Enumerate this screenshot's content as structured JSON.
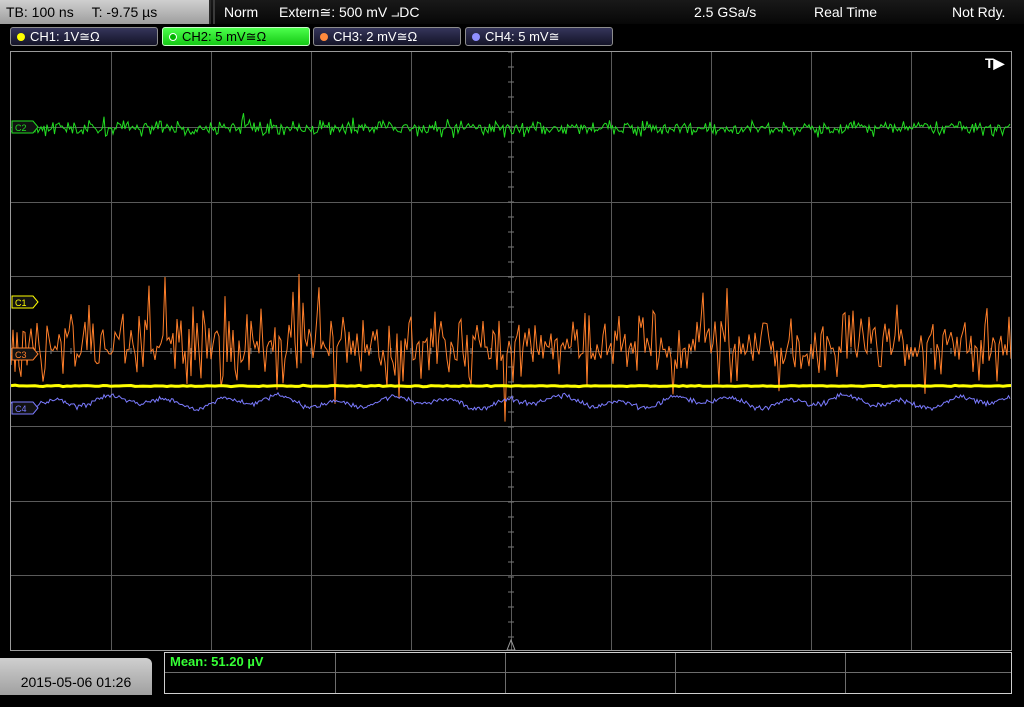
{
  "top_bar": {
    "timebase": "TB: 100 ns",
    "trigger_time": "T: -9.75 µs",
    "mode": "Norm",
    "trigger_source": "Extern≅: 500 mV ⨼DC",
    "sample_rate": "2.5 GSa/s",
    "acquisition_mode": "Real Time",
    "status": "Not Rdy."
  },
  "channels": [
    {
      "label": "CH1: 1V≅Ω",
      "color": "#ffff00",
      "active": false
    },
    {
      "label": "CH2: 5 mV≅Ω",
      "color": "#00e000",
      "active": true
    },
    {
      "label": "CH3: 2 mV≅Ω",
      "color": "#ff8a3d",
      "active": false
    },
    {
      "label": "CH4: 5 mV≅",
      "color": "#8080ff",
      "active": false
    }
  ],
  "markers": {
    "ch1": "C1",
    "ch2": "C2",
    "ch3": "C3",
    "ch4": "C4",
    "trigger_position": "T▶"
  },
  "bottom": {
    "datetime": "2015-05-06 01:26",
    "measurement": "Mean: 51.20 µV"
  },
  "colors": {
    "ch1": "#ffff00",
    "ch2": "#22dd22",
    "ch3": "#ff7f2a",
    "ch4": "#7b7bff",
    "grid": "#5a5a5a"
  }
}
